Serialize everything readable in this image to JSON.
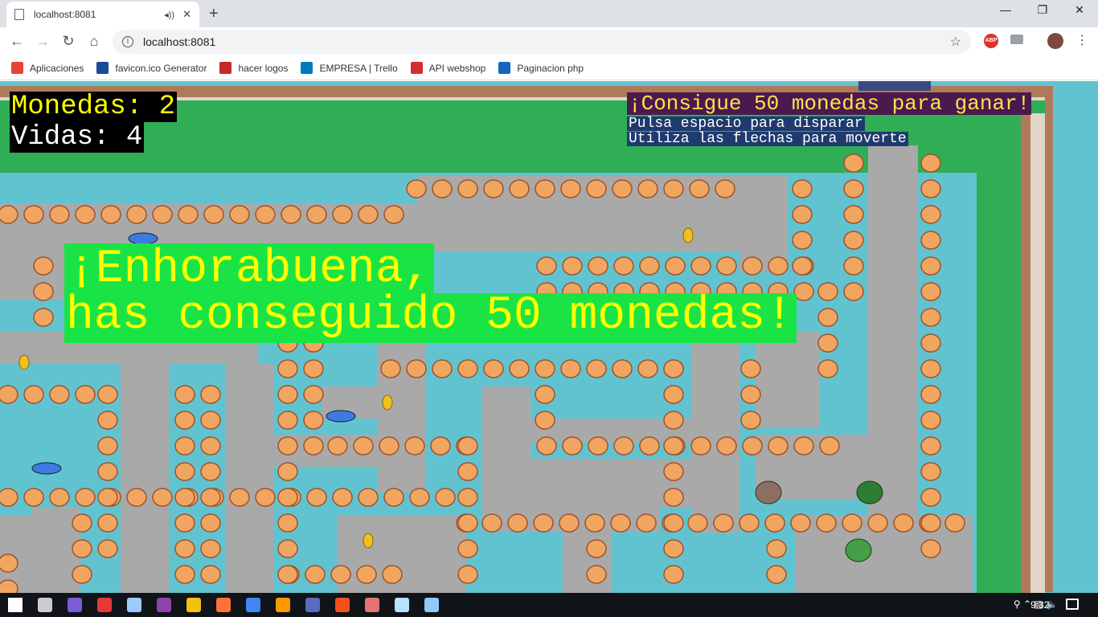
{
  "browser": {
    "tab_title": "localhost:8081",
    "url": "localhost:8081",
    "window_controls": [
      "minimize-icon",
      "restore-icon",
      "close-icon"
    ],
    "bookmarks": [
      {
        "label": "Aplicaciones",
        "icon": "apps-grid-icon",
        "color": "#e84335"
      },
      {
        "label": "favicon.ico Generator",
        "icon": "favicon-generator-icon",
        "color": "#1a4b9b"
      },
      {
        "label": "hacer logos",
        "icon": "logo-maker-icon",
        "color": "#c62828"
      },
      {
        "label": "EMPRESA | Trello",
        "icon": "trello-icon",
        "color": "#0079bf"
      },
      {
        "label": "API webshop",
        "icon": "webshop-icon",
        "color": "#d32f2f"
      },
      {
        "label": "Paginacion php",
        "icon": "php-icon",
        "color": "#1565c0"
      }
    ]
  },
  "game": {
    "monedas_text": "Monedas: 2",
    "vidas_text": "Vidas: 4",
    "objective": "¡Consigue 50 monedas para ganar!",
    "hint_shoot": "Pulsa espacio para disparar",
    "hint_move": "Utiliza las flechas para moverte",
    "win_line1": "¡Enhorabuena,",
    "win_line2": "has conseguido 50 monedas!",
    "colors": {
      "water": "#62c3d0",
      "grass": "#2fae55",
      "stone": "#a9a9a9",
      "wall": "#b07a5a",
      "shell": "#f0a660",
      "coin": "#f0c020",
      "win_bg": "#1ae445",
      "win_text": "#ffff00"
    }
  },
  "taskbar": {
    "time": "9:32",
    "apps": [
      "windows-start-icon",
      "task-view-icon",
      "app-purple-icon",
      "app-red-icon",
      "app-cube-icon",
      "visual-studio-icon",
      "file-explorer-icon",
      "firefox-icon",
      "chrome-icon",
      "sublime-text-icon",
      "app-grid-icon",
      "git-icon",
      "app-paint-icon",
      "notepad-icon",
      "app-window-icon"
    ]
  }
}
